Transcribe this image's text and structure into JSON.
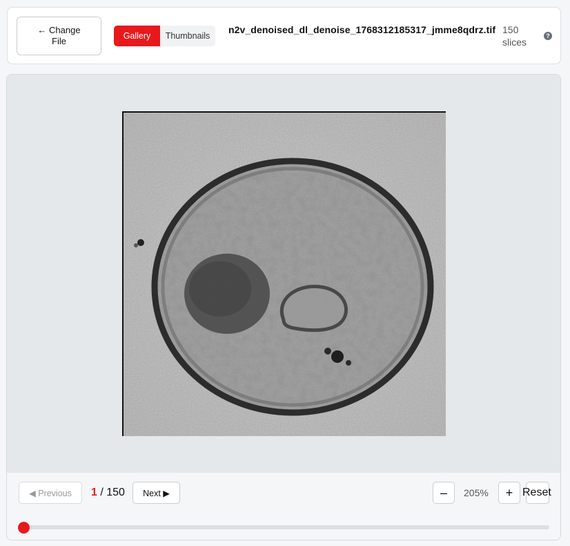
{
  "header": {
    "change_file_label": "← Change File",
    "tabs": [
      {
        "label": "Gallery",
        "active": true
      },
      {
        "label": "Thumbnails",
        "active": false
      }
    ],
    "filename": "n2v_denoised_dl_denoise_1768312185317_jmme8qdrz.tif",
    "slice_count_label": "150 slices",
    "help_icon": "question-circle-icon",
    "help_glyph": "?"
  },
  "viewer": {
    "image_desc_icon": "microscopy-slice-image"
  },
  "controls": {
    "previous_label": "◀ Previous",
    "next_label": "Next ▶",
    "current_slice": "1",
    "total_label": "/ 150",
    "zoom_out_label": "–",
    "zoom_level": "205%",
    "zoom_in_label": "+",
    "reset_label": "Reset",
    "slider_value": 1,
    "slider_max": 150
  },
  "colors": {
    "accent": "#e8191d",
    "background": "#f5f6f8",
    "canvas_bg": "#e5e8eb"
  }
}
